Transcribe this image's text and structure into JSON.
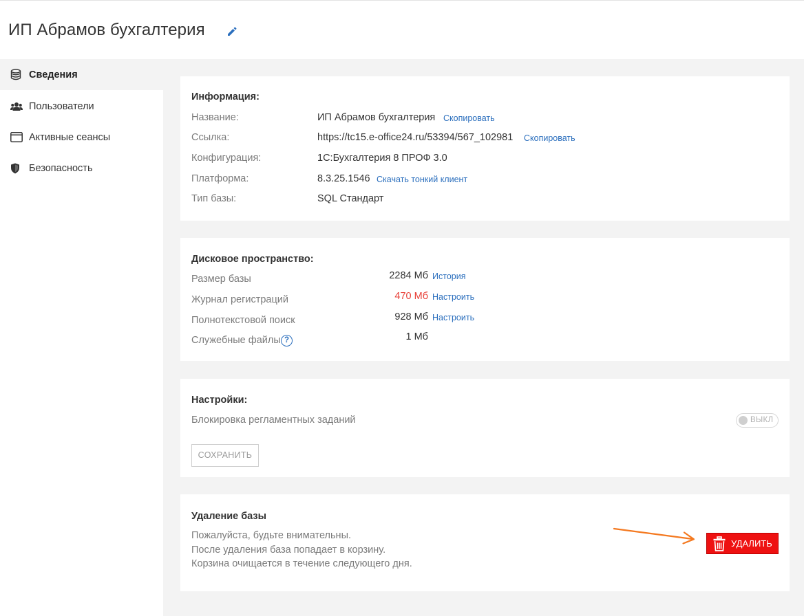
{
  "header": {
    "title": "ИП Абрамов бухгалтерия",
    "edit_icon": "pencil-icon"
  },
  "sidebar": {
    "items": [
      {
        "label": "Сведения",
        "icon": "database-icon",
        "active": true
      },
      {
        "label": "Пользователи",
        "icon": "users-icon",
        "active": false
      },
      {
        "label": "Активные сеансы",
        "icon": "window-icon",
        "active": false
      },
      {
        "label": "Безопасность",
        "icon": "shield-icon",
        "active": false
      }
    ]
  },
  "info": {
    "title": "Информация:",
    "rows": [
      {
        "label": "Название:",
        "value": "ИП Абрамов бухгалтерия",
        "link": "Скопировать"
      },
      {
        "label": "Ссылка:",
        "value": "https://tc15.e-office24.ru/53394/567_102981",
        "link": "Скопировать"
      },
      {
        "label": "Конфигурация:",
        "value": "1С:Бухгалтерия 8 ПРОФ 3.0",
        "link": ""
      },
      {
        "label": "Платформа:",
        "value": "8.3.25.1546",
        "link": "Скачать тонкий клиент"
      },
      {
        "label": "Тип базы:",
        "value": "SQL Стандарт",
        "link": ""
      }
    ]
  },
  "disk": {
    "title": "Дисковое пространство:",
    "rows": [
      {
        "label": "Размер базы",
        "value": "2284 Мб",
        "link": "История"
      },
      {
        "label": "Журнал регистраций",
        "value": "470 Мб",
        "link": "Настроить",
        "value_color": "#e8423a"
      },
      {
        "label": "Полнотекстовой поиск",
        "value": "928 Мб",
        "link": "Настроить"
      },
      {
        "label": "Служебные файлы",
        "value": "1 Мб",
        "link": "",
        "help": "?"
      }
    ]
  },
  "settings": {
    "title": "Настройки:",
    "block_label": "Блокировка регламентных заданий",
    "toggle_label": "ВЫКЛ",
    "toggle_on": false,
    "save_label": "СОХРАНИТЬ"
  },
  "delete": {
    "title": "Удаление базы",
    "lines": [
      "Пожалуйста, будьте внимательны.",
      "После удаления база попадает в корзину.",
      "Корзина очищается в течение следующего дня."
    ],
    "button_label": "УДАЛИТЬ",
    "button_icon": "trash-icon",
    "button_color": "#ee1111",
    "arrow_color": "#f47920"
  },
  "colors": {
    "accent_link": "#2a6ebd",
    "page_bg": "#f3f3f3",
    "warning_value": "#e8423a"
  }
}
